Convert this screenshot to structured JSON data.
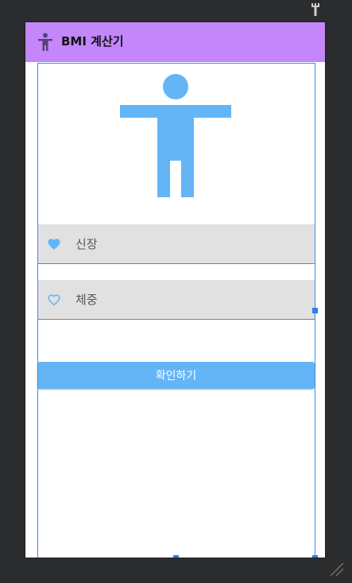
{
  "app_bar": {
    "title": "BMI 계산기",
    "icon": "accessibility-icon",
    "color": "#c387fb"
  },
  "hero": {
    "icon": "accessibility-figure-icon",
    "color": "#64b5f6"
  },
  "form": {
    "height": {
      "hint": "신장",
      "icon": "heart-filled-icon"
    },
    "weight": {
      "hint": "체중",
      "icon": "heart-outline-icon"
    },
    "confirm_label": "확인하기",
    "accent": "#64b5f6"
  }
}
